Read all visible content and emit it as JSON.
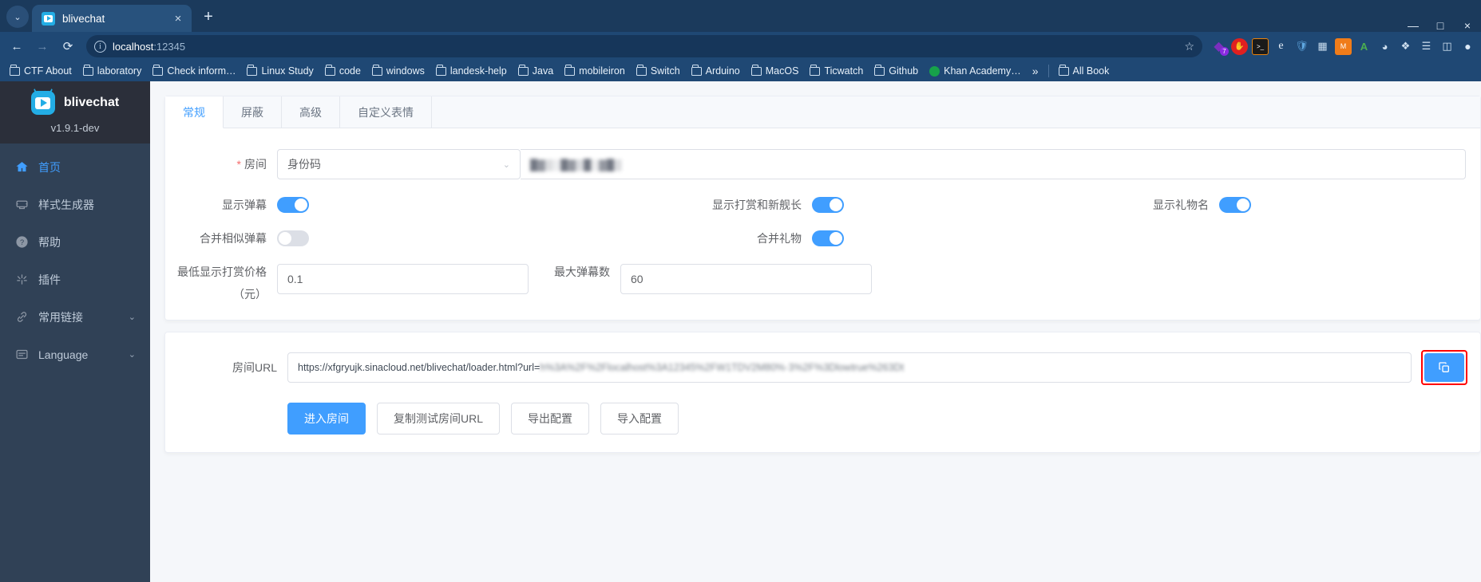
{
  "browser": {
    "tab": {
      "title": "blivechat",
      "favicon": "blivechat-favicon",
      "close_label": "×"
    },
    "newtab_label": "+",
    "tabstrip_chevron": "⌄",
    "window_controls": {
      "minimize": "—",
      "maximize": "□",
      "close": "×"
    },
    "nav": {
      "back": "←",
      "forward": "→",
      "reload": "⟳"
    },
    "omnibox": {
      "url_host": "localhost",
      "url_port": ":12345",
      "info_icon": "ⓘ",
      "star_icon": "☆"
    },
    "extensions": [
      {
        "name": "purple-layers-extension",
        "glyph": "◆",
        "badge": "7"
      },
      {
        "name": "red-stop-hand-extension",
        "glyph": "✋"
      },
      {
        "name": "terminal-extension",
        "glyph": ">_"
      },
      {
        "name": "edge-style-extension",
        "glyph": "e"
      },
      {
        "name": "shield-extension",
        "glyph": "⛨"
      },
      {
        "name": "grid-extension",
        "glyph": "⊞"
      },
      {
        "name": "orange-square-extension",
        "glyph": "■"
      },
      {
        "name": "letter-a-extension",
        "glyph": "A"
      },
      {
        "name": "wifi-extension",
        "glyph": "◑"
      },
      {
        "name": "puzzle-extension",
        "glyph": "❖"
      },
      {
        "name": "reading-list-extension",
        "glyph": "☰"
      },
      {
        "name": "sidepanel-extension",
        "glyph": "◫"
      },
      {
        "name": "profile-avatar",
        "glyph": "●"
      }
    ],
    "bookmarks": [
      {
        "label": "CTF About",
        "icon": "folder-icon"
      },
      {
        "label": "laboratory",
        "icon": "folder-icon"
      },
      {
        "label": "Check inform…",
        "icon": "folder-icon"
      },
      {
        "label": "Linux Study",
        "icon": "folder-icon"
      },
      {
        "label": "code",
        "icon": "folder-icon"
      },
      {
        "label": "windows",
        "icon": "folder-icon"
      },
      {
        "label": "landesk-help",
        "icon": "folder-icon"
      },
      {
        "label": "Java",
        "icon": "folder-icon"
      },
      {
        "label": "mobileiron",
        "icon": "folder-icon"
      },
      {
        "label": "Switch",
        "icon": "folder-icon"
      },
      {
        "label": "Arduino",
        "icon": "folder-icon"
      },
      {
        "label": "MacOS",
        "icon": "folder-icon"
      },
      {
        "label": "Ticwatch",
        "icon": "folder-icon"
      },
      {
        "label": "Github",
        "icon": "folder-icon"
      },
      {
        "label": "Khan Academy…",
        "icon": "globe-icon"
      }
    ],
    "bookmarks_overflow": "»",
    "all_bookmarks_label": "All Book"
  },
  "sidebar": {
    "logo_text": "blivechat",
    "version": "v1.9.1-dev",
    "items": [
      {
        "label": "首页",
        "icon": "home-icon",
        "active": true,
        "expandable": false
      },
      {
        "label": "样式生成器",
        "icon": "style-generator-icon",
        "active": false,
        "expandable": false
      },
      {
        "label": "帮助",
        "icon": "help-circle-icon",
        "active": false,
        "expandable": false
      },
      {
        "label": "插件",
        "icon": "plugin-icon",
        "active": false,
        "expandable": false
      },
      {
        "label": "常用链接",
        "icon": "link-icon",
        "active": false,
        "expandable": true
      },
      {
        "label": "Language",
        "icon": "language-icon",
        "active": false,
        "expandable": true
      }
    ],
    "expand_arrow": "⌄"
  },
  "main": {
    "tabs": [
      {
        "label": "常规",
        "active": true
      },
      {
        "label": "屏蔽",
        "active": false
      },
      {
        "label": "高级",
        "active": false
      },
      {
        "label": "自定义表情",
        "active": false
      }
    ],
    "room": {
      "label": "房间",
      "required_mark": "*",
      "select_value": "身份码",
      "select_caret": "⌄",
      "value_redacted": "█▓▒░█▓▒█░▓█▒"
    },
    "switches": [
      {
        "label": "显示弹幕",
        "on": true
      },
      {
        "label": "显示打赏和新舰长",
        "on": true
      },
      {
        "label": "显示礼物名",
        "on": true
      },
      {
        "label": "合并相似弹幕",
        "on": false
      },
      {
        "label": "合并礼物",
        "on": true
      }
    ],
    "min_price": {
      "label": "最低显示打赏价格",
      "value": "0.1",
      "unit_note": "（元）"
    },
    "max_danmaku": {
      "label": "最大弹幕数",
      "value": "60"
    },
    "room_url": {
      "label": "房间URL",
      "value_prefix": "https://xfgryujk.sinacloud.net/blivechat/loader.html?url=",
      "value_redacted_1": "h%3A%2F%2Flocalhost%3A12345%2F",
      "value_redacted_2": "W1TDV2M80%·3",
      "value_redacted_3": "%2F%3Dlow",
      "value_redacted_4": "true%26",
      "value_redacted_5": "3Dt",
      "copy_icon": "copy-icon"
    },
    "buttons": [
      {
        "label": "进入房间",
        "primary": true
      },
      {
        "label": "复制测试房间URL",
        "primary": false
      },
      {
        "label": "导出配置",
        "primary": false
      },
      {
        "label": "导入配置",
        "primary": false
      }
    ]
  },
  "colors": {
    "accent": "#409eff",
    "sidebar_bg": "#304156",
    "browser_chrome": "#1f4874",
    "highlight_border": "#ff0000"
  }
}
